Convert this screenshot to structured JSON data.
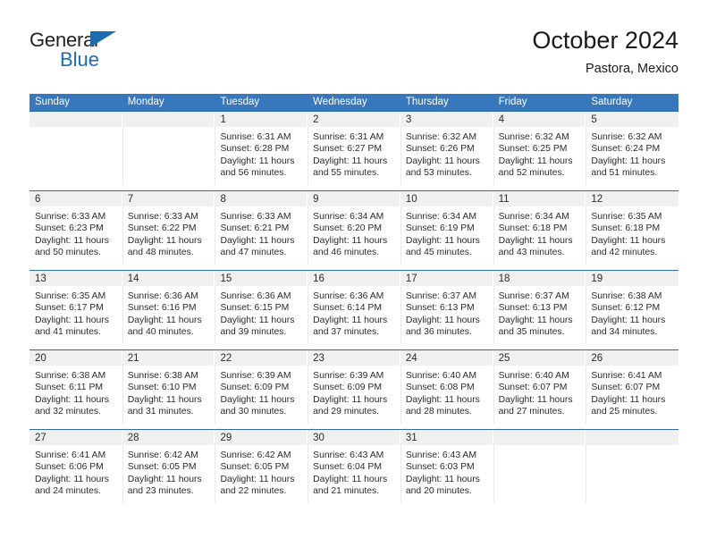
{
  "logo": {
    "word_one": "General",
    "word_two": "Blue",
    "triangle_color": "#1b6cb0",
    "text_color": "#231f20"
  },
  "header": {
    "title": "October 2024",
    "subtitle": "Pastora, Mexico"
  },
  "theme": {
    "header_blue": "#3777bc",
    "row_divider": "#2b6ca8",
    "numband_gray": "#f0f0f0"
  },
  "weekdays": [
    "Sunday",
    "Monday",
    "Tuesday",
    "Wednesday",
    "Thursday",
    "Friday",
    "Saturday"
  ],
  "weeks": [
    [
      {
        "day": "",
        "sunrise": "",
        "sunset": "",
        "daylight": ""
      },
      {
        "day": "",
        "sunrise": "",
        "sunset": "",
        "daylight": ""
      },
      {
        "day": "1",
        "sunrise": "Sunrise: 6:31 AM",
        "sunset": "Sunset: 6:28 PM",
        "daylight": "Daylight: 11 hours and 56 minutes."
      },
      {
        "day": "2",
        "sunrise": "Sunrise: 6:31 AM",
        "sunset": "Sunset: 6:27 PM",
        "daylight": "Daylight: 11 hours and 55 minutes."
      },
      {
        "day": "3",
        "sunrise": "Sunrise: 6:32 AM",
        "sunset": "Sunset: 6:26 PM",
        "daylight": "Daylight: 11 hours and 53 minutes."
      },
      {
        "day": "4",
        "sunrise": "Sunrise: 6:32 AM",
        "sunset": "Sunset: 6:25 PM",
        "daylight": "Daylight: 11 hours and 52 minutes."
      },
      {
        "day": "5",
        "sunrise": "Sunrise: 6:32 AM",
        "sunset": "Sunset: 6:24 PM",
        "daylight": "Daylight: 11 hours and 51 minutes."
      }
    ],
    [
      {
        "day": "6",
        "sunrise": "Sunrise: 6:33 AM",
        "sunset": "Sunset: 6:23 PM",
        "daylight": "Daylight: 11 hours and 50 minutes."
      },
      {
        "day": "7",
        "sunrise": "Sunrise: 6:33 AM",
        "sunset": "Sunset: 6:22 PM",
        "daylight": "Daylight: 11 hours and 48 minutes."
      },
      {
        "day": "8",
        "sunrise": "Sunrise: 6:33 AM",
        "sunset": "Sunset: 6:21 PM",
        "daylight": "Daylight: 11 hours and 47 minutes."
      },
      {
        "day": "9",
        "sunrise": "Sunrise: 6:34 AM",
        "sunset": "Sunset: 6:20 PM",
        "daylight": "Daylight: 11 hours and 46 minutes."
      },
      {
        "day": "10",
        "sunrise": "Sunrise: 6:34 AM",
        "sunset": "Sunset: 6:19 PM",
        "daylight": "Daylight: 11 hours and 45 minutes."
      },
      {
        "day": "11",
        "sunrise": "Sunrise: 6:34 AM",
        "sunset": "Sunset: 6:18 PM",
        "daylight": "Daylight: 11 hours and 43 minutes."
      },
      {
        "day": "12",
        "sunrise": "Sunrise: 6:35 AM",
        "sunset": "Sunset: 6:18 PM",
        "daylight": "Daylight: 11 hours and 42 minutes."
      }
    ],
    [
      {
        "day": "13",
        "sunrise": "Sunrise: 6:35 AM",
        "sunset": "Sunset: 6:17 PM",
        "daylight": "Daylight: 11 hours and 41 minutes."
      },
      {
        "day": "14",
        "sunrise": "Sunrise: 6:36 AM",
        "sunset": "Sunset: 6:16 PM",
        "daylight": "Daylight: 11 hours and 40 minutes."
      },
      {
        "day": "15",
        "sunrise": "Sunrise: 6:36 AM",
        "sunset": "Sunset: 6:15 PM",
        "daylight": "Daylight: 11 hours and 39 minutes."
      },
      {
        "day": "16",
        "sunrise": "Sunrise: 6:36 AM",
        "sunset": "Sunset: 6:14 PM",
        "daylight": "Daylight: 11 hours and 37 minutes."
      },
      {
        "day": "17",
        "sunrise": "Sunrise: 6:37 AM",
        "sunset": "Sunset: 6:13 PM",
        "daylight": "Daylight: 11 hours and 36 minutes."
      },
      {
        "day": "18",
        "sunrise": "Sunrise: 6:37 AM",
        "sunset": "Sunset: 6:13 PM",
        "daylight": "Daylight: 11 hours and 35 minutes."
      },
      {
        "day": "19",
        "sunrise": "Sunrise: 6:38 AM",
        "sunset": "Sunset: 6:12 PM",
        "daylight": "Daylight: 11 hours and 34 minutes."
      }
    ],
    [
      {
        "day": "20",
        "sunrise": "Sunrise: 6:38 AM",
        "sunset": "Sunset: 6:11 PM",
        "daylight": "Daylight: 11 hours and 32 minutes."
      },
      {
        "day": "21",
        "sunrise": "Sunrise: 6:38 AM",
        "sunset": "Sunset: 6:10 PM",
        "daylight": "Daylight: 11 hours and 31 minutes."
      },
      {
        "day": "22",
        "sunrise": "Sunrise: 6:39 AM",
        "sunset": "Sunset: 6:09 PM",
        "daylight": "Daylight: 11 hours and 30 minutes."
      },
      {
        "day": "23",
        "sunrise": "Sunrise: 6:39 AM",
        "sunset": "Sunset: 6:09 PM",
        "daylight": "Daylight: 11 hours and 29 minutes."
      },
      {
        "day": "24",
        "sunrise": "Sunrise: 6:40 AM",
        "sunset": "Sunset: 6:08 PM",
        "daylight": "Daylight: 11 hours and 28 minutes."
      },
      {
        "day": "25",
        "sunrise": "Sunrise: 6:40 AM",
        "sunset": "Sunset: 6:07 PM",
        "daylight": "Daylight: 11 hours and 27 minutes."
      },
      {
        "day": "26",
        "sunrise": "Sunrise: 6:41 AM",
        "sunset": "Sunset: 6:07 PM",
        "daylight": "Daylight: 11 hours and 25 minutes."
      }
    ],
    [
      {
        "day": "27",
        "sunrise": "Sunrise: 6:41 AM",
        "sunset": "Sunset: 6:06 PM",
        "daylight": "Daylight: 11 hours and 24 minutes."
      },
      {
        "day": "28",
        "sunrise": "Sunrise: 6:42 AM",
        "sunset": "Sunset: 6:05 PM",
        "daylight": "Daylight: 11 hours and 23 minutes."
      },
      {
        "day": "29",
        "sunrise": "Sunrise: 6:42 AM",
        "sunset": "Sunset: 6:05 PM",
        "daylight": "Daylight: 11 hours and 22 minutes."
      },
      {
        "day": "30",
        "sunrise": "Sunrise: 6:43 AM",
        "sunset": "Sunset: 6:04 PM",
        "daylight": "Daylight: 11 hours and 21 minutes."
      },
      {
        "day": "31",
        "sunrise": "Sunrise: 6:43 AM",
        "sunset": "Sunset: 6:03 PM",
        "daylight": "Daylight: 11 hours and 20 minutes."
      },
      {
        "day": "",
        "sunrise": "",
        "sunset": "",
        "daylight": ""
      },
      {
        "day": "",
        "sunrise": "",
        "sunset": "",
        "daylight": ""
      }
    ]
  ]
}
